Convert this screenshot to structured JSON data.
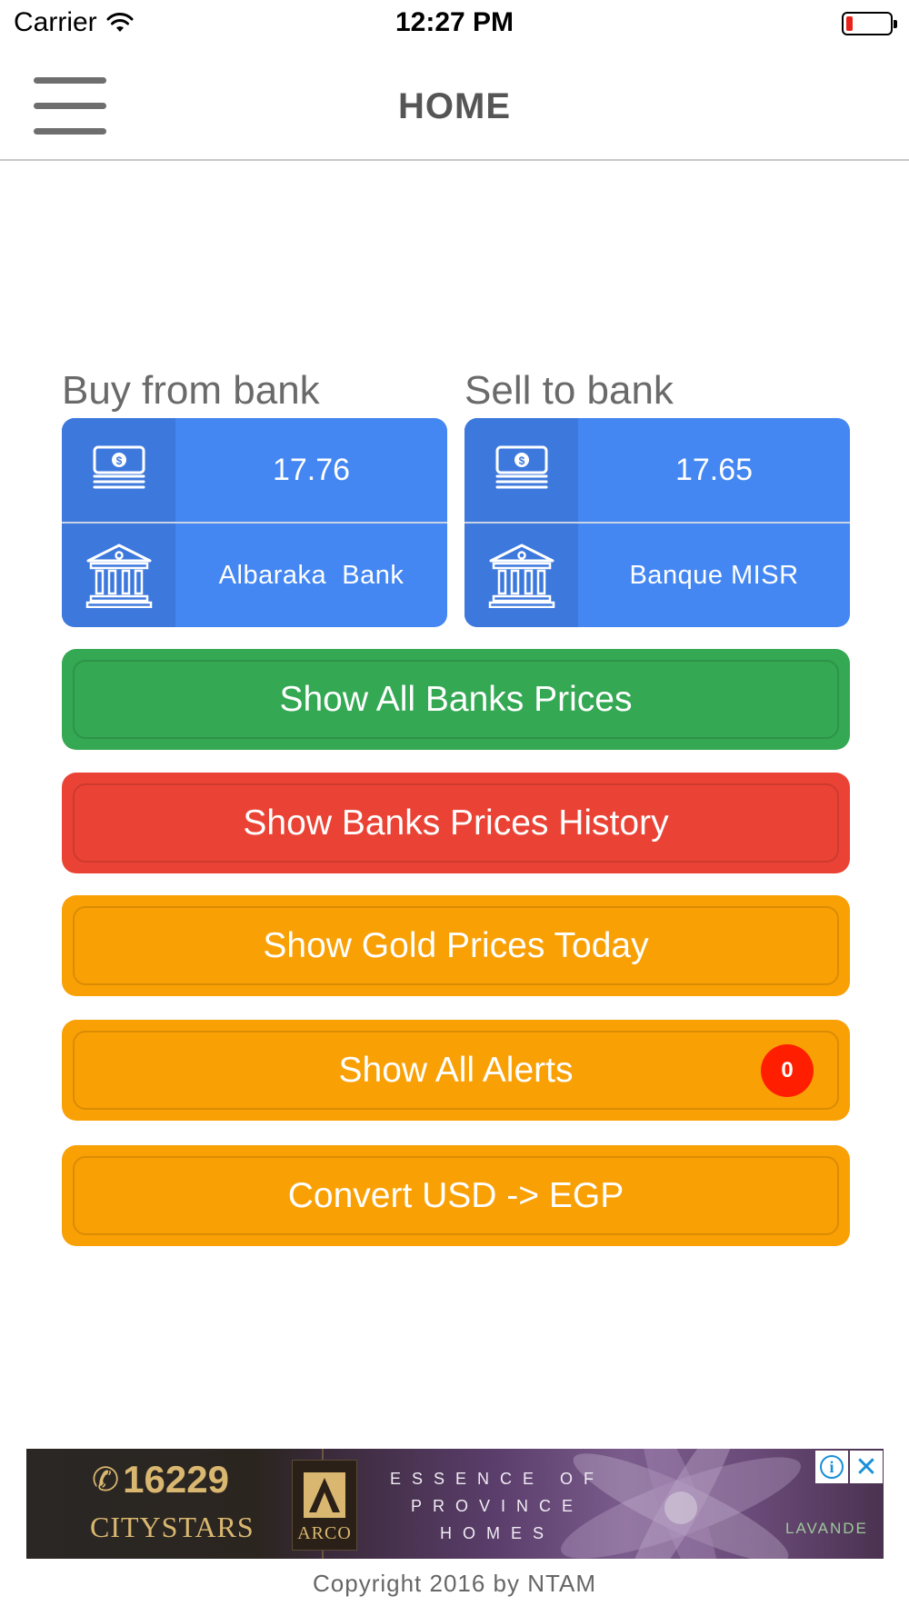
{
  "status_bar": {
    "carrier": "Carrier",
    "time": "12:27 PM",
    "battery_level": 0.15,
    "battery_color": "#e8221b"
  },
  "nav": {
    "title": "HOME",
    "menu_icon": "hamburger-menu-icon"
  },
  "buy": {
    "label": "Buy from bank",
    "price": "17.76",
    "bank": "Albaraka  Bank",
    "money_icon": "money-icon",
    "bank_icon": "bank-building-icon"
  },
  "sell": {
    "label": "Sell to bank",
    "price": "17.65",
    "bank": "Banque MISR",
    "money_icon": "money-icon",
    "bank_icon": "bank-building-icon"
  },
  "actions": {
    "all_banks": "Show All Banks Prices",
    "history": "Show Banks Prices History",
    "gold": "Show Gold Prices Today",
    "alerts": "Show All Alerts",
    "alerts_count": "0",
    "convert": "Convert USD -> EGP"
  },
  "colors": {
    "card_blue": "#4487f2",
    "green": "#34a853",
    "red": "#ea4335",
    "orange": "#f9a005",
    "badge": "#ff1f00"
  },
  "ad": {
    "phone": "16229",
    "brand": "CITYSTARS",
    "arco": "ARCO",
    "tagline_1": "ESSENCE OF",
    "tagline_2": "PROVINCE",
    "tagline_3": "HOMES",
    "lavande": "LAVANDE",
    "info_icon": "ad-info-icon",
    "close_icon": "ad-close-icon"
  },
  "footer": {
    "copyright": "Copyright 2016 by NTAM"
  }
}
